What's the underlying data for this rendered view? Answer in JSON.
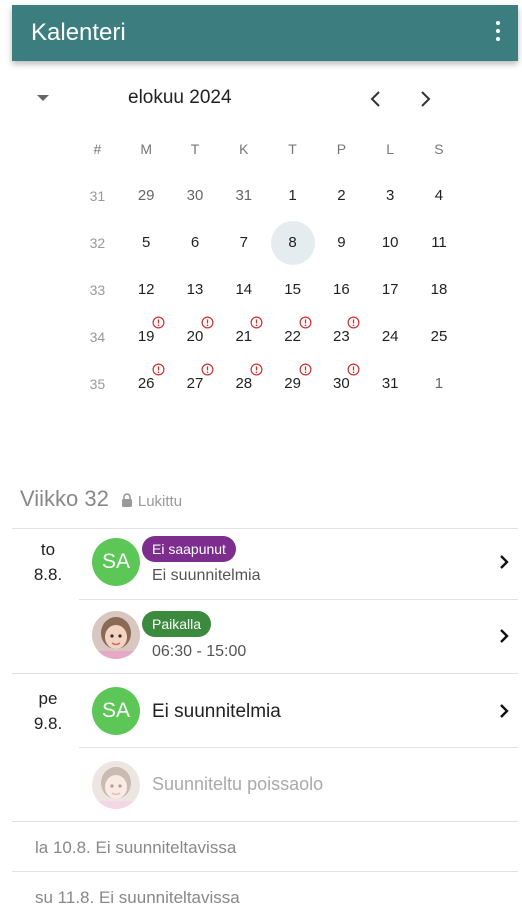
{
  "appbar": {
    "title": "Kalenteri",
    "menu_icon": "more-vert-icon"
  },
  "calendar": {
    "month_title": "elokuu 2024",
    "headers": [
      "#",
      "M",
      "T",
      "K",
      "T",
      "P",
      "L",
      "S"
    ],
    "weeks": [
      {
        "week": "31",
        "days": [
          "29",
          "30",
          "31",
          "1",
          "2",
          "3",
          "4"
        ],
        "muted": [
          0,
          1,
          2
        ],
        "warn": []
      },
      {
        "week": "32",
        "days": [
          "5",
          "6",
          "7",
          "8",
          "9",
          "10",
          "11"
        ],
        "muted": [],
        "warn": [],
        "today": 3
      },
      {
        "week": "33",
        "days": [
          "12",
          "13",
          "14",
          "15",
          "16",
          "17",
          "18"
        ],
        "muted": [],
        "warn": []
      },
      {
        "week": "34",
        "days": [
          "19",
          "20",
          "21",
          "22",
          "23",
          "24",
          "25"
        ],
        "muted": [],
        "warn": [
          0,
          1,
          2,
          3,
          4
        ]
      },
      {
        "week": "35",
        "days": [
          "26",
          "27",
          "28",
          "29",
          "30",
          "31",
          "1"
        ],
        "muted": [
          6
        ],
        "warn": [
          0,
          1,
          2,
          3,
          4
        ]
      }
    ]
  },
  "week": {
    "title": "Viikko 32",
    "lock_label": "Lukittu"
  },
  "days": {
    "thu": {
      "weekday": "to",
      "date": "8.8."
    },
    "fri": {
      "weekday": "pe",
      "date": "9.8."
    }
  },
  "rows": {
    "r1": {
      "avatar": "SA",
      "badge": "Ei saapunut",
      "text": "Ei suunnitelmia"
    },
    "r2": {
      "badge": "Paikalla",
      "text": "06:30 - 15:00"
    },
    "r3": {
      "avatar": "SA",
      "text": "Ei suunnitelmia"
    },
    "r4": {
      "text": "Suunniteltu poissaolo"
    }
  },
  "footer": {
    "sat": "la 10.8. Ei suunniteltavissa",
    "sun": "su 11.8. Ei suunniteltavissa"
  },
  "colors": {
    "appbar": "#3c7e7f",
    "initials_avatar": "#5cc756",
    "badge_absent": "#7d2d8e",
    "badge_present": "#3b8a3e",
    "warning": "#d32f2f"
  }
}
